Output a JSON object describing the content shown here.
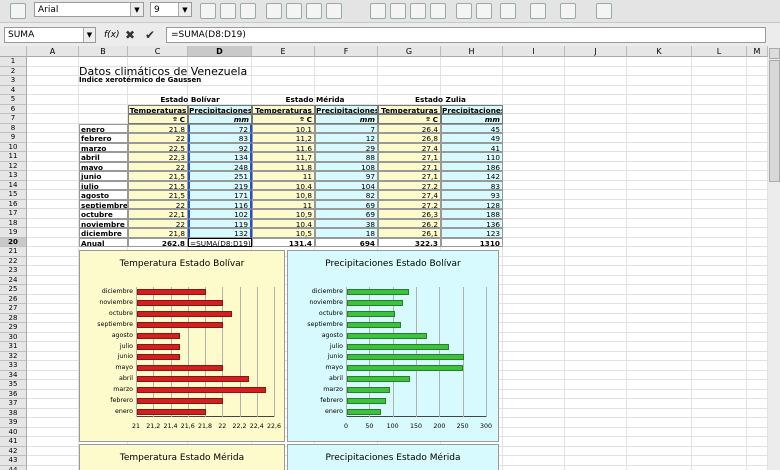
{
  "toolbar": {
    "font_name": "Arial",
    "font_size": "9"
  },
  "formula_bar": {
    "name_box": "SUMA",
    "fx_label": "f(x)",
    "cancel_glyph": "✖",
    "accept_glyph": "✔",
    "formula": "=SUMA(D8:D19)"
  },
  "columns": [
    "A",
    "B",
    "C",
    "D",
    "E",
    "F",
    "G",
    "H",
    "I",
    "J",
    "K",
    "L",
    "M"
  ],
  "rows": [
    "1",
    "2",
    "3",
    "4",
    "5",
    "6",
    "7",
    "8",
    "9",
    "10",
    "11",
    "12",
    "13",
    "14",
    "15",
    "16",
    "17",
    "18",
    "19",
    "20",
    "21",
    "22",
    "23",
    "24",
    "25",
    "26",
    "27",
    "28",
    "29",
    "30",
    "31",
    "32",
    "33",
    "34",
    "35",
    "36",
    "37",
    "38",
    "39",
    "40",
    "41",
    "42",
    "43",
    "44",
    "45"
  ],
  "sheet": {
    "title": "Datos climáticos de Venezuela",
    "subtitle": "Índice xerotérmico de Gaussen",
    "regions": [
      "Estado Bolívar",
      "Estado Mérida",
      "Estado Zulia"
    ],
    "col_temp": "Temperaturas",
    "col_precip": "Precipitaciones",
    "unit_temp": "º C",
    "unit_precip": "mm",
    "months": [
      "enero",
      "febrero",
      "marzo",
      "abril",
      "mayo",
      "junio",
      "julio",
      "agosto",
      "septiembre",
      "octubre",
      "noviembre",
      "diciembre"
    ],
    "bolivar_temp": [
      "21,8",
      "22",
      "22,5",
      "22,3",
      "22",
      "21,5",
      "21,5",
      "21,5",
      "22",
      "22,1",
      "22",
      "21,8"
    ],
    "bolivar_precip": [
      "72",
      "83",
      "92",
      "134",
      "248",
      "251",
      "219",
      "171",
      "116",
      "102",
      "119",
      "132"
    ],
    "merida_temp": [
      "10,1",
      "11,2",
      "11,6",
      "11,7",
      "11,8",
      "11",
      "10,4",
      "10,8",
      "11",
      "10,9",
      "10,4",
      "10,5"
    ],
    "merida_precip": [
      "7",
      "12",
      "29",
      "88",
      "108",
      "97",
      "104",
      "82",
      "69",
      "69",
      "38",
      "18"
    ],
    "zulia_temp": [
      "26,4",
      "26,8",
      "27,4",
      "27,1",
      "27,1",
      "27,1",
      "27,2",
      "27,4",
      "27,2",
      "26,3",
      "26,2",
      "26,1"
    ],
    "zulia_precip": [
      "45",
      "49",
      "41",
      "110",
      "186",
      "142",
      "83",
      "93",
      "128",
      "188",
      "136",
      "123"
    ],
    "annual_label": "Anual",
    "annual_bolivar_temp": "262,8",
    "annual_bolivar_precip": "=SUMA(D8:D19)",
    "annual_merida_temp": "131,4",
    "annual_merida_precip": "694",
    "annual_zulia_temp": "322,3",
    "annual_zulia_precip": "1310"
  },
  "charts_bottom": {
    "left_title": "Temperatura Estado Mérida",
    "right_title": "Precipitaciones Estado Mérida"
  },
  "chart_data": [
    {
      "type": "bar",
      "orientation": "horizontal",
      "title": "Temperatura Estado Bolívar",
      "categories": [
        "diciembre",
        "noviembre",
        "octubre",
        "septiembre",
        "agosto",
        "julio",
        "junio",
        "mayo",
        "abril",
        "marzo",
        "febrero",
        "enero"
      ],
      "values": [
        21.8,
        22,
        22.1,
        22,
        21.5,
        21.5,
        21.5,
        22,
        22.3,
        22.5,
        22,
        21.8
      ],
      "xlim": [
        21,
        22.6
      ],
      "ticks": [
        "21",
        "21,2",
        "21,4",
        "21,6",
        "21,8",
        "22",
        "22,2",
        "22,4",
        "22,6"
      ],
      "color": "#d21f1f",
      "background": "#fdfbcc"
    },
    {
      "type": "bar",
      "orientation": "horizontal",
      "title": "Precipitaciones Estado Bolívar",
      "categories": [
        "diciembre",
        "noviembre",
        "octubre",
        "septiembre",
        "agosto",
        "julio",
        "junio",
        "mayo",
        "abril",
        "marzo",
        "febrero",
        "enero"
      ],
      "values": [
        132,
        119,
        102,
        116,
        171,
        219,
        251,
        248,
        134,
        92,
        83,
        72
      ],
      "xlim": [
        0,
        300
      ],
      "ticks": [
        "0",
        "50",
        "100",
        "150",
        "200",
        "250",
        "300"
      ],
      "color": "#3cc23c",
      "background": "#d6fafd"
    }
  ],
  "colors": {
    "header_yellow": "#fdfbcc",
    "header_cyan": "#d6fafd",
    "selection": "#1f4fd1"
  }
}
